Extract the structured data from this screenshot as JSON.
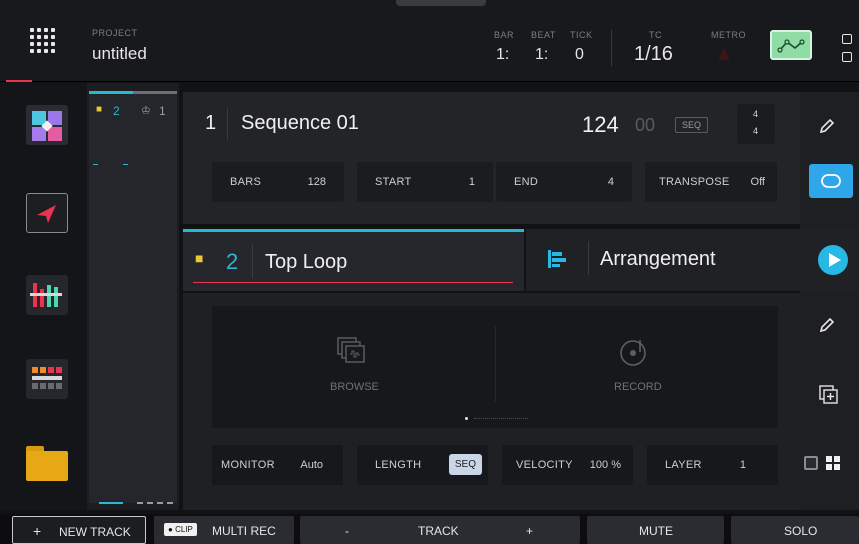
{
  "topbar": {
    "project_label": "PROJECT",
    "project_name": "untitled",
    "bar_label": "BAR",
    "bar_value": "1:",
    "beat_label": "BEAT",
    "beat_value": "1:",
    "tick_label": "TICK",
    "tick_value": "0",
    "tc_label": "TC",
    "tc_value": "1/16",
    "metro_label": "METRO"
  },
  "track_columns": {
    "col1_count": "2",
    "col2_count": "1"
  },
  "sequence": {
    "number": "1",
    "name": "Sequence 01",
    "bpm": "124",
    "bpm_fraction": "00",
    "seq_tag": "SEQ",
    "time_sig_top": "4",
    "time_sig_bottom": "4",
    "fields": {
      "bars_label": "BARS",
      "bars_value": "128",
      "start_label": "START",
      "start_value": "1",
      "end_label": "END",
      "end_value": "4",
      "transpose_label": "TRANSPOSE",
      "transpose_value": "Off"
    }
  },
  "track": {
    "number": "2",
    "name": "Top Loop",
    "arrangement_label": "Arrangement"
  },
  "pads": {
    "browse_label": "BROWSE",
    "record_label": "RECORD"
  },
  "track_fields": {
    "monitor_label": "MONITOR",
    "monitor_value": "Auto",
    "length_label": "LENGTH",
    "length_value": "SEQ",
    "velocity_label": "VELOCITY",
    "velocity_value": "100 %",
    "layer_label": "LAYER",
    "layer_value": "1"
  },
  "bottombar": {
    "new_track": "NEW TRACK",
    "new_track_plus": "+",
    "clip_badge": "CLIP",
    "multi_rec": "MULTI REC",
    "track_minus": "-",
    "track_label": "TRACK",
    "track_plus": "+",
    "mute": "MUTE",
    "solo": "SOLO"
  },
  "colors": {
    "accent_cyan": "#27b8d4",
    "accent_blue": "#2fa6ea",
    "accent_red": "#e8344f",
    "automation_green": "#8fdca7"
  }
}
